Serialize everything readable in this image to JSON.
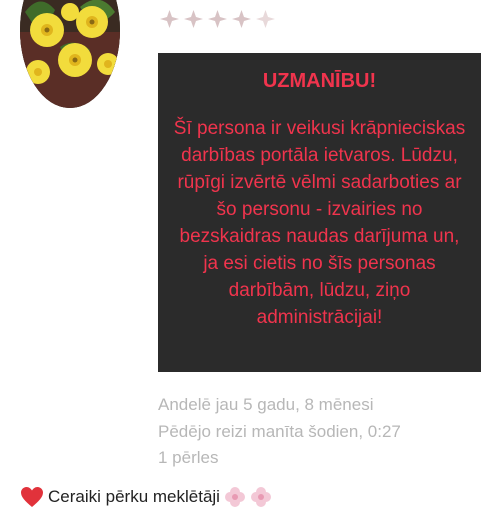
{
  "profile": {
    "avatar_icon": "yellow-flowers-photo",
    "rating_icon": "diamond-star-icon",
    "rating_count": 5,
    "rating_color": "#d8c3c5"
  },
  "warning": {
    "title": "UZMANĪBU!",
    "text": "Šī persona ir veikusi krāpnieciskas darbības portāla ietvaros. Lūdzu, rūpīgi izvērtē vēlmi sadarboties ar šo personu - izvairies no bezskaidras naudas darījuma un, ja esi cietis no šīs personas darbībām, lūdzu, ziņo administrācijai!",
    "background_color": "#2b2b2b",
    "text_color": "#f0344d"
  },
  "stats": {
    "member_since": "Andelē jau 5 gadu, 8 mēnesi",
    "last_seen": "Pēdējo reizi manīta šodien, 0:27",
    "pearls": "1 pērles"
  },
  "bio": {
    "heart_icon": "red-heart-icon",
    "text": "Ceraiki pērku meklētāji",
    "flower_icon": "pink-flower-icon"
  }
}
